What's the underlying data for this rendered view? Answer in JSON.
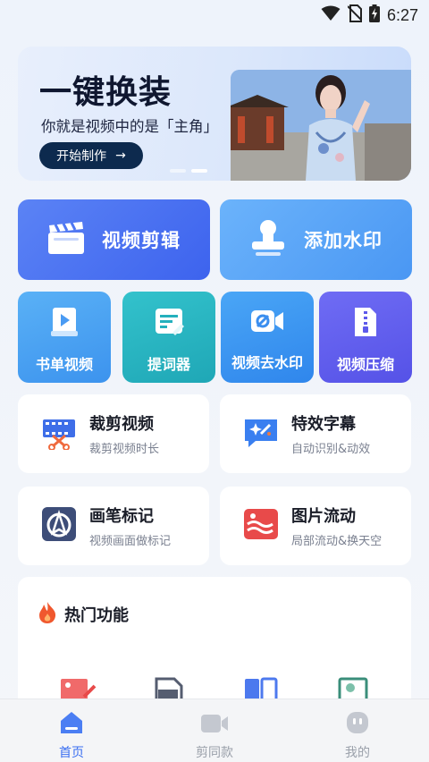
{
  "status_bar": {
    "time": "6:27"
  },
  "banner": {
    "title": "一键换装",
    "subtitle": "你就是视频中的是「主角」",
    "button_label": "开始制作",
    "button_arrow": "→"
  },
  "primary_actions": [
    {
      "label": "视频剪辑",
      "icon": "clapperboard-icon"
    },
    {
      "label": "添加水印",
      "icon": "stamp-icon"
    }
  ],
  "tools": [
    {
      "label": "书单视频",
      "icon": "book-play-icon"
    },
    {
      "label": "提词器",
      "icon": "teleprompter-icon"
    },
    {
      "label": "视频去水印",
      "icon": "video-unlink-icon"
    },
    {
      "label": "视频压缩",
      "icon": "zip-file-icon"
    }
  ],
  "features": [
    {
      "title": "裁剪视频",
      "subtitle": "裁剪视频时长",
      "icon": "film-scissors-icon"
    },
    {
      "title": "特效字幕",
      "subtitle": "自动识别&动效",
      "icon": "sparkle-chat-icon"
    },
    {
      "title": "画笔标记",
      "subtitle": "视频画面做标记",
      "icon": "pen-nib-icon"
    },
    {
      "title": "图片流动",
      "subtitle": "局部流动&换天空",
      "icon": "wave-image-icon"
    }
  ],
  "hot_section": {
    "title": "热门功能",
    "icons": [
      "image-edit-icon",
      "mp3-file-icon",
      "split-panel-icon",
      "photo-frame-icon"
    ]
  },
  "bottom_nav": [
    {
      "label": "首页",
      "icon": "home-icon",
      "active": true
    },
    {
      "label": "剪同款",
      "icon": "video-camera-icon",
      "active": false
    },
    {
      "label": "我的",
      "icon": "profile-face-icon",
      "active": false
    }
  ],
  "colors": {
    "accent": "#3a6ff1",
    "dark_button": "#0d2a4e"
  }
}
